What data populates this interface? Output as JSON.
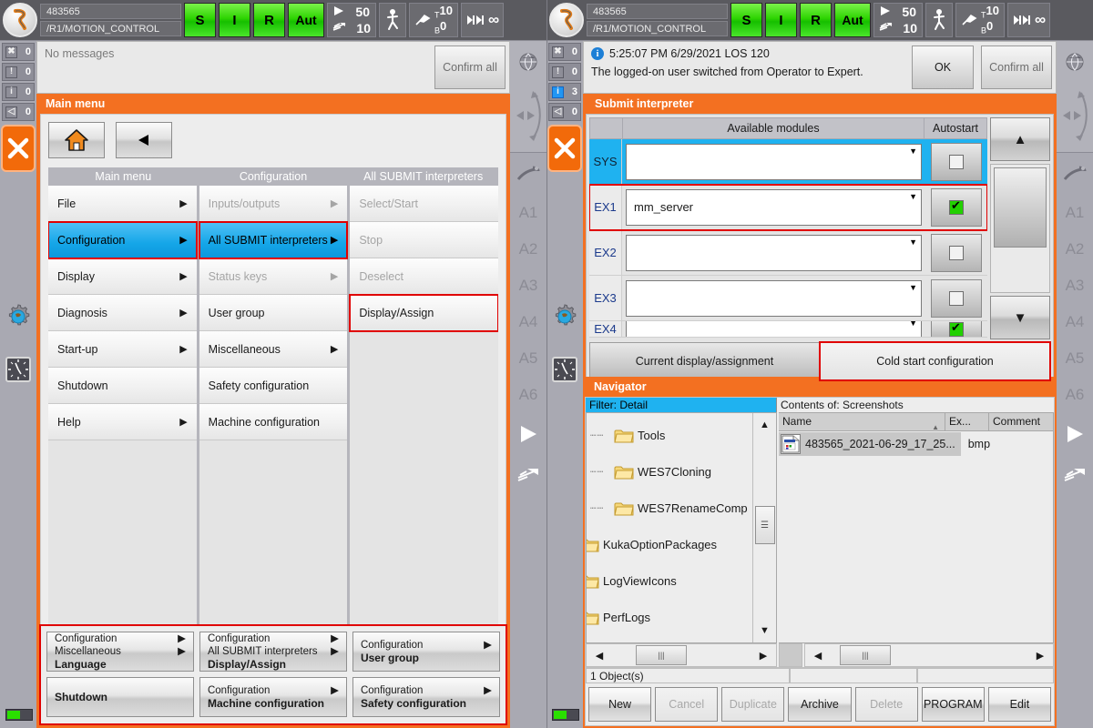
{
  "header": {
    "robot_name": "483565",
    "program_path": "/R1/MOTION_CONTROL",
    "status_keys": [
      "S",
      "I",
      "R",
      "Aut"
    ],
    "override_program": "50",
    "override_jog": "10",
    "tool_label": "T",
    "tool_number": "10",
    "base_label": "B",
    "base_number": "0",
    "increment": "∞"
  },
  "left": {
    "message_counts": [
      {
        "icon": "error-icon",
        "glyph": "✖",
        "count": "0",
        "active": false
      },
      {
        "icon": "warning-icon",
        "glyph": "!",
        "count": "0",
        "active": false
      },
      {
        "icon": "info-icon",
        "glyph": "i",
        "count": "0",
        "active": false
      },
      {
        "icon": "waiting-icon",
        "glyph": "◁",
        "count": "0",
        "active": false
      }
    ],
    "message_text": "No messages",
    "confirm_all_label": "Confirm all",
    "window_title": "Main menu",
    "columns": [
      {
        "title": "Main menu",
        "items": [
          {
            "label": "File",
            "arrow": true,
            "dim": false,
            "selected": false,
            "highlight": false
          },
          {
            "label": "Configuration",
            "arrow": true,
            "dim": false,
            "selected": true,
            "highlight": true
          },
          {
            "label": "Display",
            "arrow": true,
            "dim": false,
            "selected": false,
            "highlight": false
          },
          {
            "label": "Diagnosis",
            "arrow": true,
            "dim": false,
            "selected": false,
            "highlight": false
          },
          {
            "label": "Start-up",
            "arrow": true,
            "dim": false,
            "selected": false,
            "highlight": false
          },
          {
            "label": "Shutdown",
            "arrow": false,
            "dim": false,
            "selected": false,
            "highlight": false
          },
          {
            "label": "Help",
            "arrow": true,
            "dim": false,
            "selected": false,
            "highlight": false
          }
        ]
      },
      {
        "title": "Configuration",
        "items": [
          {
            "label": "Inputs/outputs",
            "arrow": true,
            "dim": true,
            "selected": false,
            "highlight": false
          },
          {
            "label": "All SUBMIT interpreters",
            "arrow": true,
            "dim": false,
            "selected": true,
            "highlight": true
          },
          {
            "label": "Status keys",
            "arrow": true,
            "dim": true,
            "selected": false,
            "highlight": false
          },
          {
            "label": "User group",
            "arrow": false,
            "dim": false,
            "selected": false,
            "highlight": false
          },
          {
            "label": "Miscellaneous",
            "arrow": true,
            "dim": false,
            "selected": false,
            "highlight": false
          },
          {
            "label": "Safety configuration",
            "arrow": false,
            "dim": false,
            "selected": false,
            "highlight": false
          },
          {
            "label": "Machine configuration",
            "arrow": false,
            "dim": false,
            "selected": false,
            "highlight": false
          }
        ]
      },
      {
        "title": "All SUBMIT interpreters",
        "items": [
          {
            "label": "Select/Start",
            "arrow": false,
            "dim": true,
            "selected": false,
            "highlight": false
          },
          {
            "label": "Stop",
            "arrow": false,
            "dim": true,
            "selected": false,
            "highlight": false
          },
          {
            "label": "Deselect",
            "arrow": false,
            "dim": true,
            "selected": false,
            "highlight": false
          },
          {
            "label": "Display/Assign",
            "arrow": false,
            "dim": false,
            "selected": false,
            "highlight": true
          }
        ]
      }
    ],
    "footer_keys": [
      {
        "lines": [
          "Configuration",
          "Miscellaneous"
        ],
        "bold": "Language",
        "arrows": 2
      },
      {
        "lines": [
          "Configuration",
          "All SUBMIT interpreters"
        ],
        "bold": "Display/Assign",
        "arrows": 2
      },
      {
        "lines": [
          "Configuration"
        ],
        "bold": "User group",
        "arrows": 1
      },
      {
        "lines": [],
        "bold": "Shutdown",
        "arrows": 0
      },
      {
        "lines": [
          "Configuration"
        ],
        "bold": "Machine configuration",
        "arrows": 1
      },
      {
        "lines": [
          "Configuration"
        ],
        "bold": "Safety configuration",
        "arrows": 1
      }
    ]
  },
  "right": {
    "message_counts": [
      {
        "icon": "error-icon",
        "glyph": "✖",
        "count": "0",
        "active": false
      },
      {
        "icon": "warning-icon",
        "glyph": "!",
        "count": "0",
        "active": false
      },
      {
        "icon": "info-icon",
        "glyph": "i",
        "count": "3",
        "active": true
      },
      {
        "icon": "waiting-icon",
        "glyph": "◁",
        "count": "0",
        "active": false
      }
    ],
    "message_timestamp": "5:25:07 PM 6/29/2021 LOS 120",
    "message_body": "The logged-on user switched from Operator to Expert.",
    "ok_label": "OK",
    "confirm_all_label": "Confirm all",
    "submit": {
      "title": "Submit interpreter",
      "col_modules": "Available modules",
      "col_autostart": "Autostart",
      "rows": [
        {
          "index": "SYS",
          "module": "",
          "autostart": false,
          "selected": true,
          "highlight": false
        },
        {
          "index": "EX1",
          "module": "mm_server",
          "autostart": true,
          "selected": false,
          "highlight": true
        },
        {
          "index": "EX2",
          "module": "",
          "autostart": false,
          "selected": false,
          "highlight": false
        },
        {
          "index": "EX3",
          "module": "",
          "autostart": false,
          "selected": false,
          "highlight": false
        },
        {
          "index": "EX4",
          "module": "",
          "autostart": true,
          "selected": false,
          "highlight": false
        }
      ],
      "tab_current": "Current display/assignment",
      "tab_coldstart": "Cold start configuration"
    },
    "navigator": {
      "title": "Navigator",
      "filter_label": "Filter: Detail",
      "contents_label": "Contents of: Screenshots",
      "tree": [
        {
          "label": "Tools",
          "indent": true
        },
        {
          "label": "WES7Cloning",
          "indent": true
        },
        {
          "label": "WES7RenameComp",
          "indent": true
        },
        {
          "label": "KukaOptionPackages",
          "indent": false
        },
        {
          "label": "LogViewIcons",
          "indent": false
        },
        {
          "label": "PerfLogs",
          "indent": false
        }
      ],
      "list_headers": [
        "Name",
        "Ex...",
        "Comment"
      ],
      "list_rows": [
        {
          "name": "483565_2021-06-29_17_25...",
          "ext": "bmp",
          "comment": ""
        }
      ],
      "status": "1 Object(s)",
      "commands": [
        {
          "label": "New",
          "disabled": false
        },
        {
          "label": "Cancel",
          "disabled": true
        },
        {
          "label": "Duplicate",
          "disabled": true
        },
        {
          "label": "Archive",
          "disabled": false
        },
        {
          "label": "Delete",
          "disabled": true
        },
        {
          "label": "PROGRAM",
          "disabled": false
        },
        {
          "label": "Edit",
          "disabled": false
        }
      ]
    }
  },
  "rail_right": {
    "axes": [
      "A1",
      "A2",
      "A3",
      "A4",
      "A5",
      "A6"
    ]
  },
  "colors": {
    "orange": "#f37021",
    "blue_select": "#15a6e8",
    "red_highlight": "#e00000",
    "green_status": "#2ed402"
  }
}
